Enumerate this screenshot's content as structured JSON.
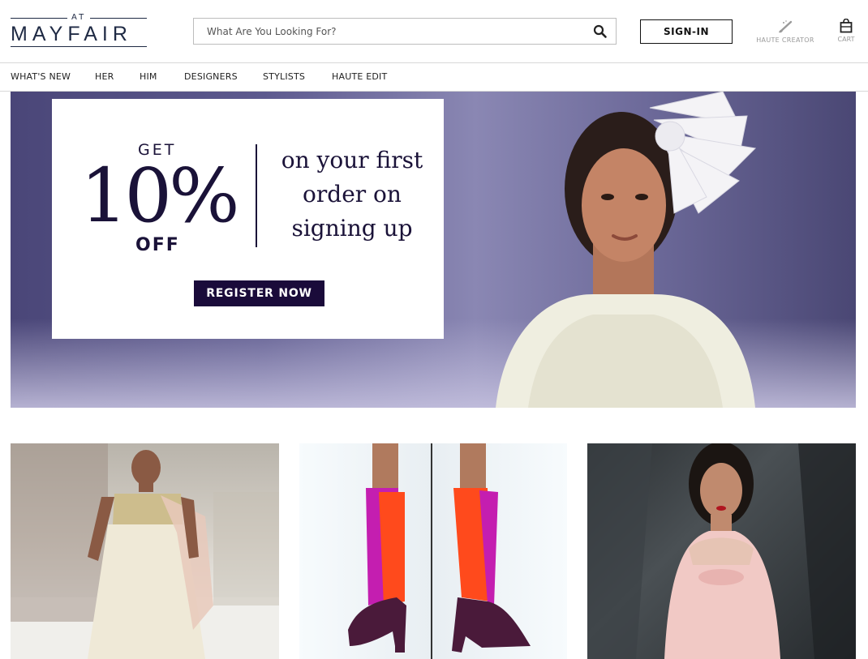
{
  "header": {
    "logo_small": "AT",
    "logo_word": "MAYFAIR",
    "search_placeholder": "What Are You Looking For?",
    "signin_label": "SIGN-IN",
    "haute_creator_label": "HAUTE CREATOR",
    "cart_label": "CART"
  },
  "nav": {
    "items": [
      "WHAT'S NEW",
      "HER",
      "HIM",
      "DESIGNERS",
      "STYLISTS",
      "HAUTE EDIT"
    ]
  },
  "hero": {
    "promo": {
      "get": "GET",
      "percent": "10%",
      "off": "OFF",
      "offer_lines": [
        "on your first",
        "order on",
        "signing up"
      ],
      "cta": "REGISTER NOW"
    }
  },
  "icons": {
    "search": "search-icon",
    "haute_creator": "brush-icon",
    "cart": "shopping-bag-icon"
  },
  "colors": {
    "brand_navy": "#1a1238",
    "cta_bg": "#1a0b3a",
    "text": "#222222",
    "muted": "#999999"
  }
}
